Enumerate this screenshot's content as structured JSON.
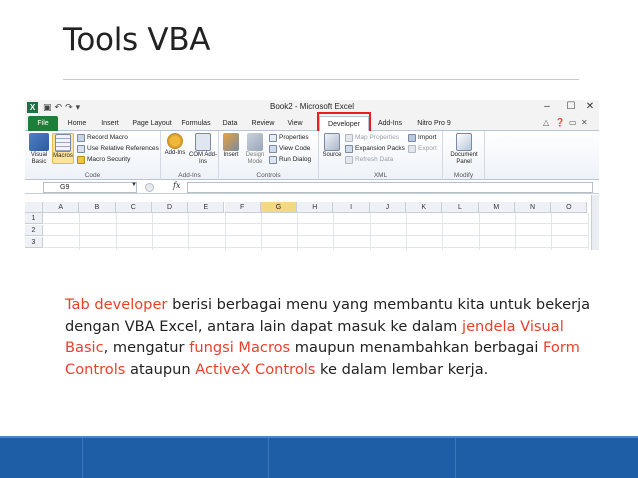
{
  "slide": {
    "title": "Tools VBA",
    "body": [
      {
        "text": "Tab developer",
        "highlight": true
      },
      {
        "text": " berisi berbagai menu yang membantu kita untuk bekerja dengan VBA Excel, antara lain dapat masuk ke dalam ",
        "highlight": false
      },
      {
        "text": "jendela Visual Basic",
        "highlight": true
      },
      {
        "text": ", mengatur ",
        "highlight": false
      },
      {
        "text": "fungsi Macros",
        "highlight": true
      },
      {
        "text": " maupun menambahkan berbagai ",
        "highlight": false
      },
      {
        "text": "Form Controls",
        "highlight": true
      },
      {
        "text": " ataupun ",
        "highlight": false
      },
      {
        "text": "ActiveX Controls",
        "highlight": true
      },
      {
        "text": " ke dalam lembar kerja.",
        "highlight": false
      }
    ],
    "colors": {
      "highlight": "#e8412a",
      "footer": "#1e5ea6",
      "callout_box": "#e5201d"
    }
  },
  "excel": {
    "app_icon": "X",
    "window_title": "Book2 - Microsoft Excel",
    "window_controls": {
      "minimize": "–",
      "maximize": "☐",
      "close": "✕"
    },
    "tabs": [
      "File",
      "Home",
      "Insert",
      "Page Layout",
      "Formulas",
      "Data",
      "Review",
      "View",
      "Developer",
      "Add-Ins",
      "Nitro Pro 9"
    ],
    "active_tab": "Developer",
    "groups": {
      "code": {
        "label": "Code",
        "visual_basic": "Visual Basic",
        "macros": "Macros",
        "record_macro": "Record Macro",
        "relative_refs": "Use Relative References",
        "macro_security": "Macro Security"
      },
      "addins": {
        "label": "Add-Ins",
        "addins_btn": "Add-Ins",
        "com_addins": "COM Add-Ins"
      },
      "controls": {
        "label": "Controls",
        "insert": "Insert",
        "design_mode": "Design Mode",
        "properties": "Properties",
        "view_code": "View Code",
        "run_dialog": "Run Dialog"
      },
      "xml": {
        "label": "XML",
        "source": "Source",
        "map_properties": "Map Properties",
        "expansion_packs": "Expansion Packs",
        "refresh_data": "Refresh Data",
        "import": "Import",
        "export": "Export"
      },
      "modify": {
        "label": "Modify",
        "document_panel": "Document Panel"
      }
    },
    "name_box": "G9",
    "fx": "fx",
    "columns": [
      "A",
      "B",
      "C",
      "D",
      "E",
      "F",
      "G",
      "H",
      "I",
      "J",
      "K",
      "L",
      "M",
      "N",
      "O"
    ],
    "selected_column": "G",
    "rows": [
      "1",
      "2",
      "3"
    ]
  }
}
